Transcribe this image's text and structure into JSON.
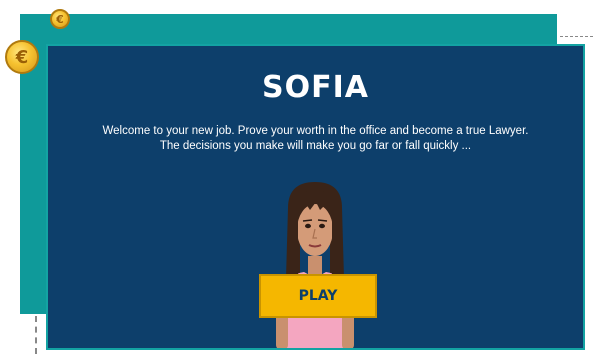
{
  "game": {
    "title": "SOFIA",
    "description_line1": "Welcome to your new job. Prove your worth in the office and become a true Lawyer.",
    "description_line2": "The decisions you make will make you go far or fall quickly ...",
    "play_label": "PLAY"
  },
  "decor": {
    "coin_symbol": "€",
    "coin_icon": "euro-coin-icon"
  },
  "colors": {
    "back_panel": "#0f9a9a",
    "front_panel": "#0d3f6b",
    "play_button": "#f5b700",
    "character_shirt": "#f4a6c0",
    "character_hair": "#3a2418"
  }
}
